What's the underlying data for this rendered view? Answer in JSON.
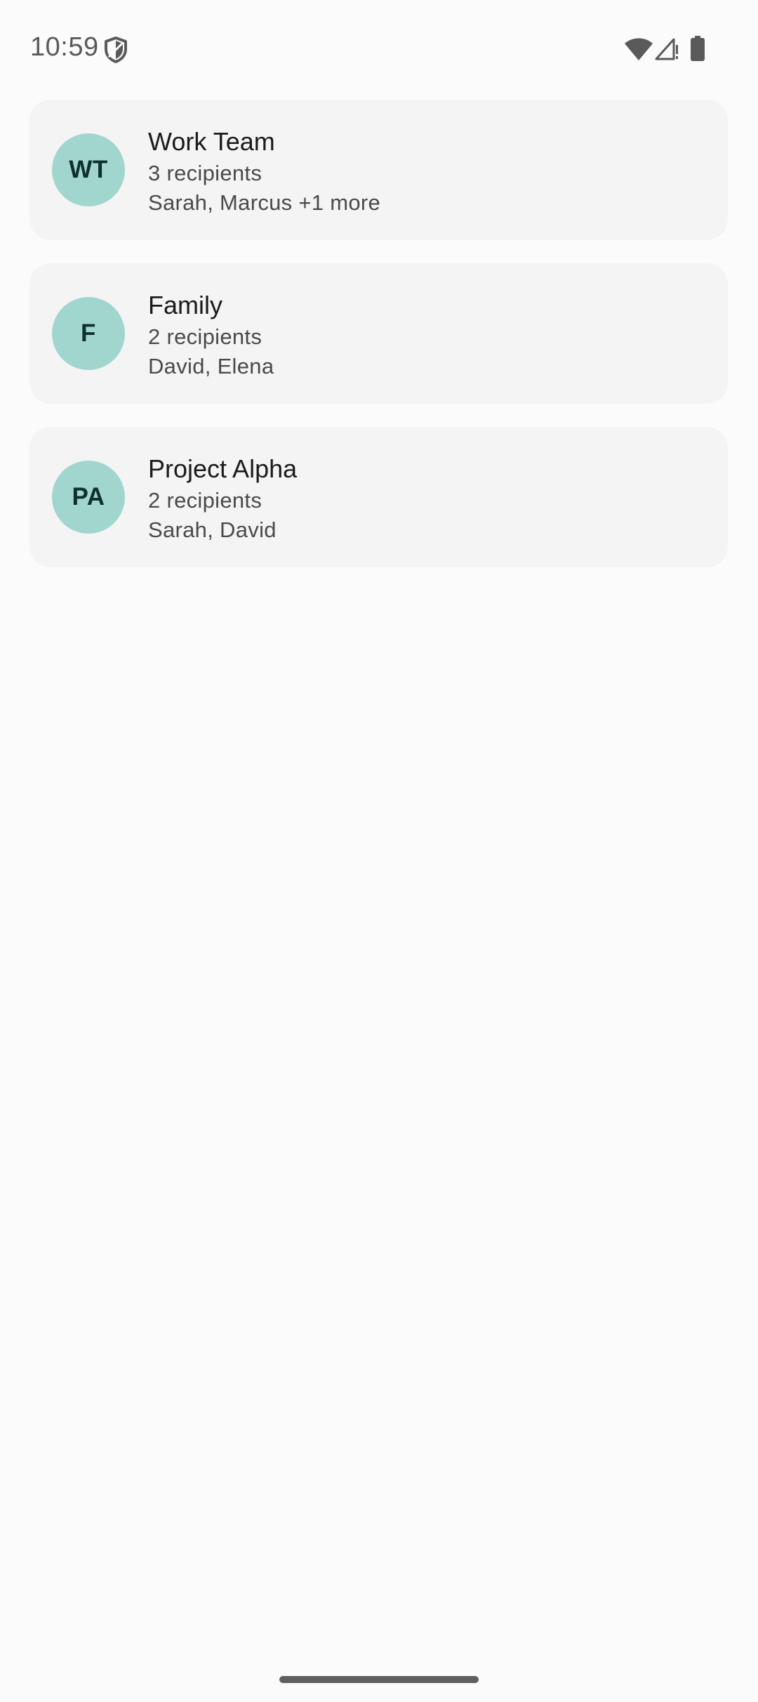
{
  "status_bar": {
    "time": "10:59",
    "icons": [
      "shield-icon",
      "wifi-icon",
      "signal-icon",
      "battery-icon"
    ]
  },
  "groups": [
    {
      "initials": "WT",
      "name": "Work Team",
      "recipients": "3 recipients",
      "members": "Sarah, Marcus +1 more"
    },
    {
      "initials": "F",
      "name": "Family",
      "recipients": "2 recipients",
      "members": "David, Elena"
    },
    {
      "initials": "PA",
      "name": "Project Alpha",
      "recipients": "2 recipients",
      "members": "Sarah, David"
    }
  ],
  "colors": {
    "background": "#fbfbfb",
    "card": "#f4f4f4",
    "avatar": "#a1d6cf",
    "avatar_text": "#10302b"
  }
}
